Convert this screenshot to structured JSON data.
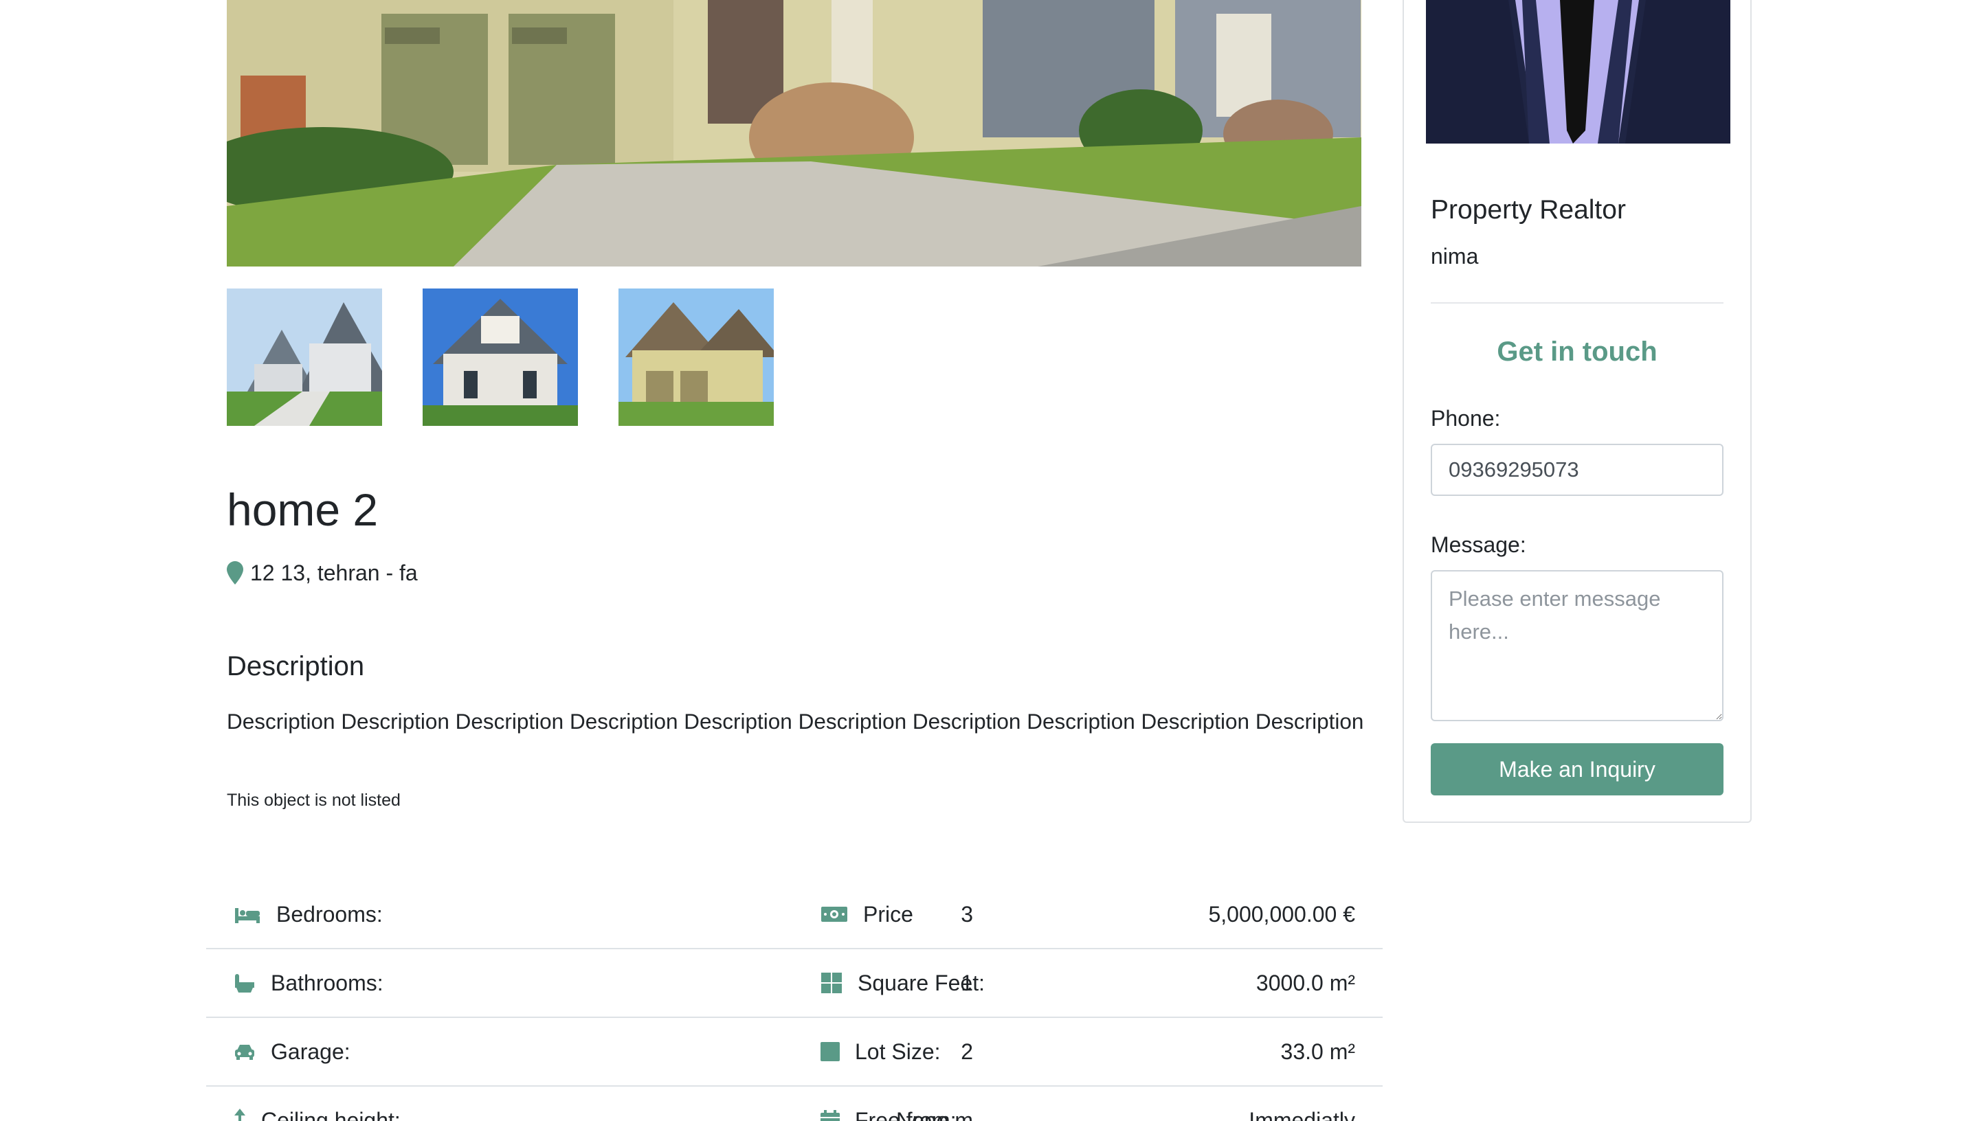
{
  "listing": {
    "title": "home 2",
    "address": "12 13, tehran - fa",
    "description_heading": "Description",
    "description": "Description Description Description Description Description Description Description Description Description Description",
    "listing_status": "This object is not listed"
  },
  "details": {
    "rows": [
      {
        "left": {
          "icon": "bed-icon",
          "label": "Bedrooms:",
          "value": "3"
        },
        "right": {
          "icon": "money-icon",
          "label": "Price",
          "value": "5,000,000.00 €"
        }
      },
      {
        "left": {
          "icon": "bath-icon",
          "label": "Bathrooms:",
          "value": "1"
        },
        "right": {
          "icon": "grid-icon",
          "label": "Square Feet:",
          "value": "3000.0 m²"
        }
      },
      {
        "left": {
          "icon": "car-icon",
          "label": "Garage:",
          "value": "2"
        },
        "right": {
          "icon": "square-icon",
          "label": "Lot Size:",
          "value": "33.0 m²"
        }
      },
      {
        "left": {
          "icon": "arrow-up-icon",
          "label": "Ceiling height:",
          "value": "None m"
        },
        "right": {
          "icon": "calendar-icon",
          "label": "Free from:",
          "value": "Immediatly"
        }
      }
    ]
  },
  "realtor": {
    "heading": "Property Realtor",
    "name": "nima"
  },
  "contact": {
    "heading": "Get in touch",
    "phone_label": "Phone:",
    "phone_value": "09369295073",
    "message_label": "Message:",
    "message_placeholder": "Please enter message here...",
    "submit_label": "Make an Inquiry"
  },
  "colors": {
    "accent": "#5a9a87",
    "text": "#212529",
    "border": "#dee2e6"
  }
}
